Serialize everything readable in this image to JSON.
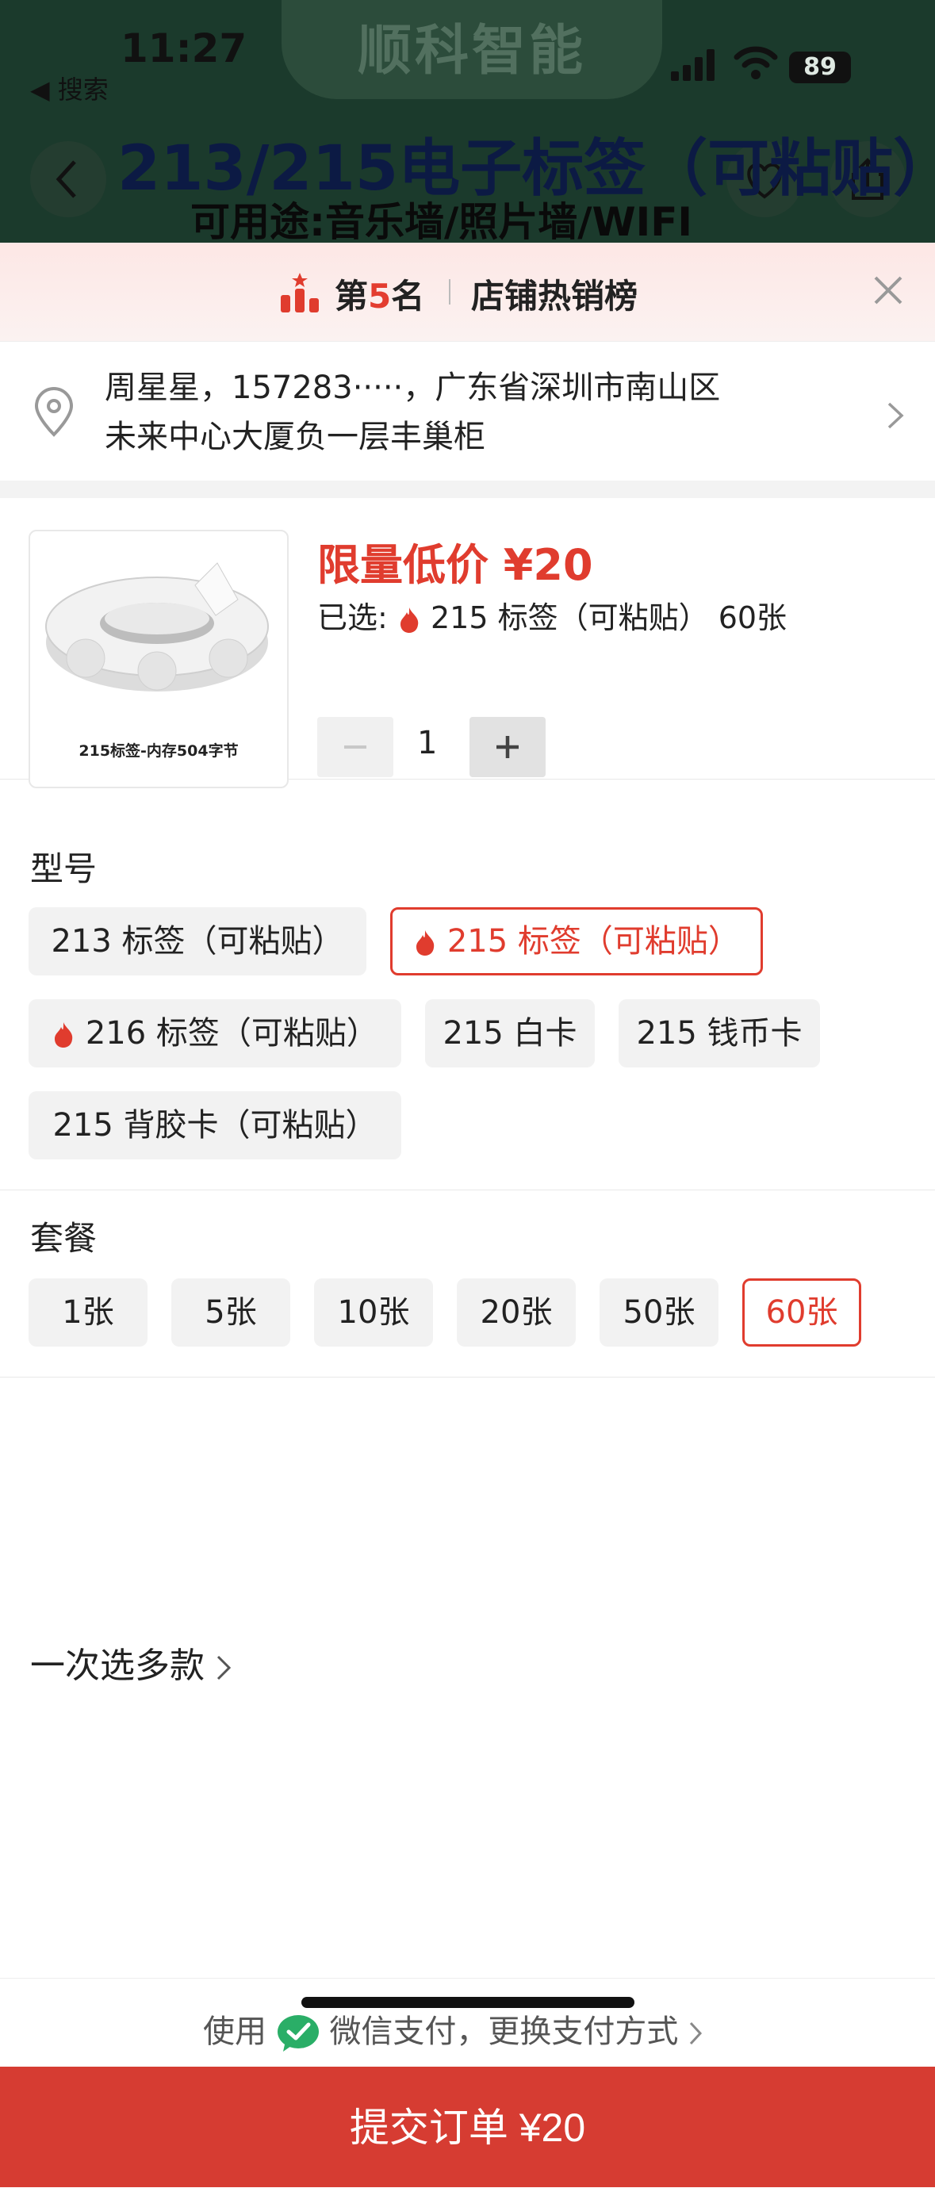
{
  "status_bar": {
    "time": "11:27",
    "back_app": "◀ 搜索",
    "battery": "89"
  },
  "background": {
    "brand": "顺科智能",
    "headline": "213/215电子标签（可粘贴）",
    "subline": "可用途:音乐墙/照片墙/WIFI"
  },
  "rank_bar": {
    "prefix": "第",
    "rank": "5",
    "suffix": "名",
    "list_name": "店铺热销榜"
  },
  "address": {
    "line1": "周星星，157283·····，广东省深圳市南山区",
    "line2": "未来中心大厦负一层丰巢柜"
  },
  "product": {
    "thumb_caption": "215标签-内存504字节",
    "price_label": "限量低价 ¥20",
    "selected_prefix": "已选:",
    "selected_value": "215 标签（可粘贴） 60张",
    "quantity": "1",
    "minus": "−",
    "plus": "+"
  },
  "model": {
    "title": "型号",
    "options": [
      {
        "label": "213 标签（可粘贴）",
        "hot": false,
        "selected": false
      },
      {
        "label": "215 标签（可粘贴）",
        "hot": true,
        "selected": true
      },
      {
        "label": "216 标签（可粘贴）",
        "hot": true,
        "selected": false
      },
      {
        "label": "215 白卡",
        "hot": false,
        "selected": false
      },
      {
        "label": "215 钱币卡",
        "hot": false,
        "selected": false
      },
      {
        "label": "215 背胶卡（可粘贴）",
        "hot": false,
        "selected": false
      }
    ]
  },
  "package": {
    "title": "套餐",
    "options": [
      {
        "label": "1张",
        "selected": false
      },
      {
        "label": "5张",
        "selected": false
      },
      {
        "label": "10张",
        "selected": false
      },
      {
        "label": "20张",
        "selected": false
      },
      {
        "label": "50张",
        "selected": false
      },
      {
        "label": "60张",
        "selected": true
      }
    ]
  },
  "multi_select": "一次选多款",
  "payment": {
    "use": "使用",
    "method": "微信支付，更换支付方式"
  },
  "submit": "提交订单 ¥20",
  "colors": {
    "accent": "#e03c2e",
    "submit_bg": "#d63c32",
    "wechat": "#2aae67"
  }
}
